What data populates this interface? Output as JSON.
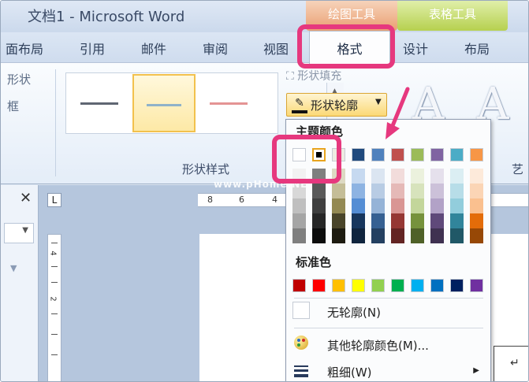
{
  "window": {
    "title": "文档1 - Microsoft Word"
  },
  "context_tabs": {
    "drawing_tools": "绘图工具",
    "table_tools": "表格工具"
  },
  "tabs": [
    {
      "label": "面布局"
    },
    {
      "label": "引用"
    },
    {
      "label": "邮件"
    },
    {
      "label": "审阅"
    },
    {
      "label": "视图"
    },
    {
      "label": "格式",
      "active": true
    },
    {
      "label": "设计"
    },
    {
      "label": "布局"
    }
  ],
  "ribbon": {
    "left_labels": [
      "形状",
      "框"
    ],
    "shape_styles_group": "形状样式",
    "shape_fill": "形状填充",
    "shape_outline": "形状轮廓",
    "art_group_partial": "艺",
    "style_swatch_colors": [
      "#5f6672",
      "#8fb2c9",
      "#e49494"
    ]
  },
  "ruler": {
    "h_numbers": [
      "8",
      "6",
      "4"
    ],
    "v_numbers": [
      "4",
      "2"
    ]
  },
  "menu": {
    "theme_colors_heading": "主题颜色",
    "theme_top_row": [
      "#ffffff",
      "#000000",
      "#eeece1",
      "#1f497d",
      "#4f81bd",
      "#c0504d",
      "#9bbb59",
      "#8064a2",
      "#4bacc6",
      "#f79646"
    ],
    "theme_shades": [
      [
        "#f2f2f2",
        "#7f7f7f",
        "#ddd9c3",
        "#c6d9f0",
        "#dbe5f1",
        "#f2dcdb",
        "#ebf1dd",
        "#e5e0ec",
        "#dbeef3",
        "#fdeada"
      ],
      [
        "#d8d8d8",
        "#595959",
        "#c4bd97",
        "#8db3e2",
        "#b8cce4",
        "#e5b9b7",
        "#d7e3bc",
        "#ccc1d9",
        "#b7dde8",
        "#fbd5b5"
      ],
      [
        "#bfbfbf",
        "#3f3f3f",
        "#938953",
        "#548dd4",
        "#95b3d7",
        "#d99694",
        "#c3d69b",
        "#b2a2c7",
        "#92cddc",
        "#fac08f"
      ],
      [
        "#a5a5a5",
        "#262626",
        "#494429",
        "#17365d",
        "#366092",
        "#953734",
        "#76923c",
        "#5f497a",
        "#31859b",
        "#e36c09"
      ],
      [
        "#7f7f7f",
        "#0c0c0c",
        "#1d1b10",
        "#0f243e",
        "#244061",
        "#632423",
        "#4f6128",
        "#3f3151",
        "#205867",
        "#974806"
      ]
    ],
    "standard_colors_heading": "标准色",
    "standard_colors": [
      "#c00000",
      "#ff0000",
      "#ffc000",
      "#ffff00",
      "#92d050",
      "#00b050",
      "#00b0f0",
      "#0070c0",
      "#002060",
      "#7030a0"
    ],
    "no_outline": "无轮廓(N)",
    "more_colors": "其他轮廓颜色(M)...",
    "weight": "粗细(W)"
  },
  "watermark": "www.pHome.NET",
  "highlight_color": "#e6387e",
  "selected_color": "#000000"
}
